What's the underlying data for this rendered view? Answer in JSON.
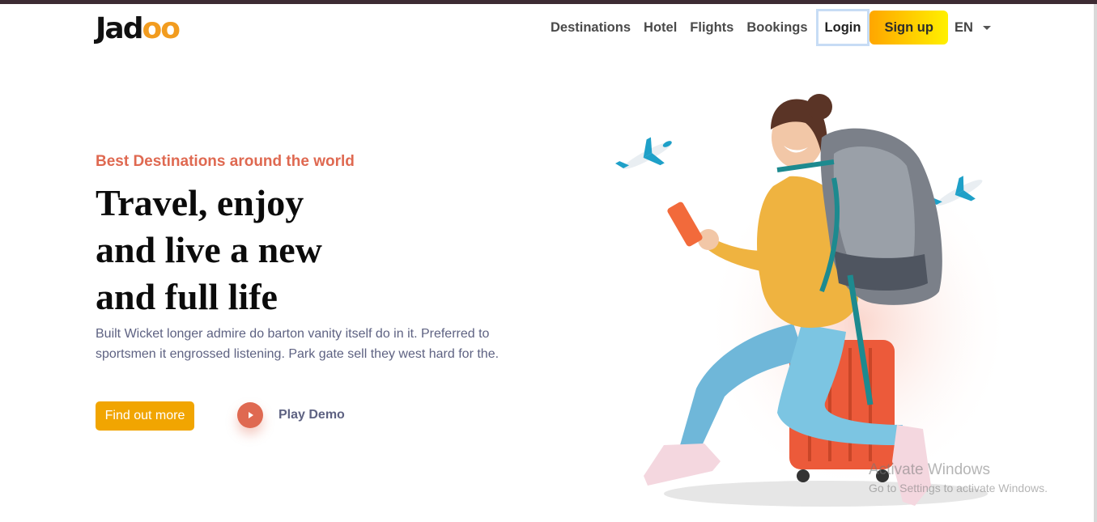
{
  "brand": {
    "logo_text": "Jad",
    "logo_accent": "oo"
  },
  "nav": {
    "destinations": "Destinations",
    "hotel": "Hotel",
    "flights": "Flights",
    "bookings": "Bookings",
    "login": "Login",
    "signup": "Sign up",
    "language": "EN"
  },
  "hero": {
    "subtitle": "Best Destinations around the world",
    "headline_lines": [
      "Travel, enjoy",
      "and live a new",
      "and full life"
    ],
    "description": "Built Wicket longer admire do barton vanity itself do in it. Preferred to sportsmen it engrossed listening. Park gate sell they west hard for the.",
    "cta_label": "Find out more",
    "play_label": "Play Demo"
  },
  "watermark": {
    "title": "Activate Windows",
    "subtitle": "Go to Settings to activate Windows."
  },
  "colors": {
    "accent_orange": "#df6951",
    "button_yellow": "#f1a501",
    "text_muted": "#5e6282"
  }
}
